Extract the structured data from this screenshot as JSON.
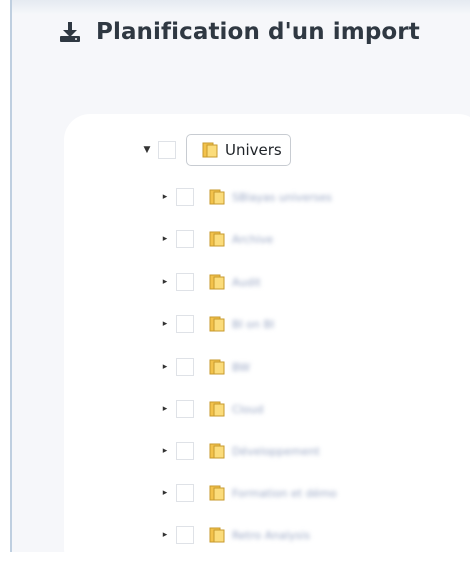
{
  "header": {
    "title": "Planification d'un import",
    "icon": "download-icon"
  },
  "tree": {
    "root": {
      "label": "Univers",
      "icon": "folder-icon",
      "expanded": true
    },
    "children": [
      {
        "label": "SBlayas universes"
      },
      {
        "label": "Archive"
      },
      {
        "label": "Audit"
      },
      {
        "label": "BI on BI"
      },
      {
        "label": "BW"
      },
      {
        "label": "Cloud"
      },
      {
        "label": "Développement"
      },
      {
        "label": "Formation et démo"
      },
      {
        "label": "Retro Analysis"
      }
    ]
  },
  "colors": {
    "title": "#2f3842",
    "panel_bg": "#f6f7fa",
    "folder_yellow": "#f3c24b",
    "blurred_label": "#9aa7c4"
  }
}
